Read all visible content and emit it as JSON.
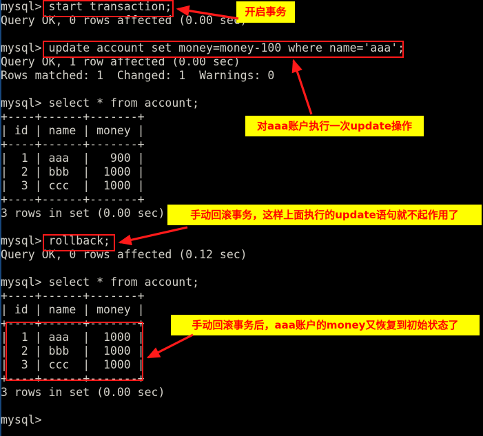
{
  "terminal": {
    "prompt": "mysql>",
    "lines": [
      "mysql> start transaction;",
      "Query OK, 0 rows affected (0.00 sec)",
      "",
      "mysql> update account set money=money-100 where name='aaa';",
      "Query OK, 1 row affected (0.00 sec)",
      "Rows matched: 1  Changed: 1  Warnings: 0",
      "",
      "mysql> select * from account;",
      "+----+------+-------+",
      "| id | name | money |",
      "+----+------+-------+",
      "|  1 | aaa  |   900 |",
      "|  2 | bbb  |  1000 |",
      "|  3 | ccc  |  1000 |",
      "+----+------+-------+",
      "3 rows in set (0.00 sec)",
      "",
      "mysql> rollback;",
      "Query OK, 0 rows affected (0.12 sec)",
      "",
      "mysql> select * from account;",
      "+----+------+-------+",
      "| id | name | money |",
      "+----+------+-------+",
      "|  1 | aaa  |  1000 |",
      "|  2 | bbb  |  1000 |",
      "|  3 | ccc  |  1000 |",
      "+----+------+-------+",
      "3 rows in set (0.00 sec)",
      "",
      "mysql>"
    ],
    "commands": {
      "start_transaction": "start transaction;",
      "update": "update account set money=money-100 where name='aaa';",
      "select": "select * from account;",
      "rollback": "rollback;"
    },
    "results": {
      "start_transaction_status": "Query OK, 0 rows affected (0.00 sec)",
      "update_status": "Query OK, 1 row affected (0.00 sec)",
      "update_detail": "Rows matched: 1  Changed: 1  Warnings: 0",
      "rollback_status": "Query OK, 0 rows affected (0.12 sec)",
      "rows_in_set": "3 rows in set (0.00 sec)"
    },
    "table_before": {
      "columns": [
        "id",
        "name",
        "money"
      ],
      "rows": [
        [
          "1",
          "aaa",
          "900"
        ],
        [
          "2",
          "bbb",
          "1000"
        ],
        [
          "3",
          "ccc",
          "1000"
        ]
      ],
      "footer": "3 rows in set (0.00 sec)"
    },
    "table_after": {
      "columns": [
        "id",
        "name",
        "money"
      ],
      "rows": [
        [
          "1",
          "aaa",
          "1000"
        ],
        [
          "2",
          "bbb",
          "1000"
        ],
        [
          "3",
          "ccc",
          "1000"
        ]
      ],
      "footer": "3 rows in set (0.00 sec)"
    }
  },
  "annotations": [
    {
      "id": "start-transaction",
      "text": "开启事务"
    },
    {
      "id": "update-once",
      "text": "对aaa账户执行一次update操作"
    },
    {
      "id": "manual-rollback",
      "text": "手动回滚事务，这样上面执行的update语句就不起作用了"
    },
    {
      "id": "after-rollback",
      "text": "手动回滚事务后，aaa账户的money又恢复到初始状态了"
    }
  ],
  "colors": {
    "background": "#000000",
    "terminal_text": "#d2d0c8",
    "highlight_box": "#ff1a1a",
    "callout_bg": "#ffff00",
    "callout_text": "#ff0000"
  }
}
